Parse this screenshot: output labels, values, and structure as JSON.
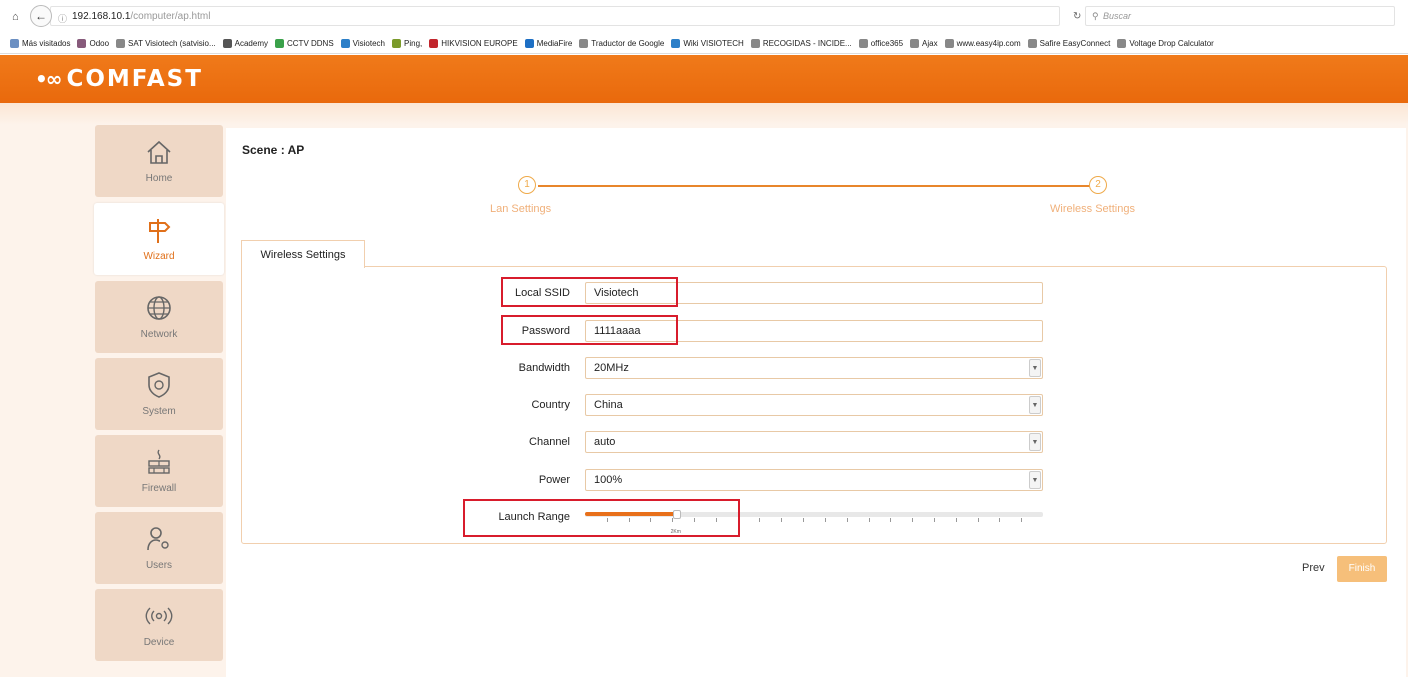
{
  "browser": {
    "url_host": "192.168.10.1",
    "url_path": "/computer/ap.html",
    "search_placeholder": "Buscar",
    "bookmarks": [
      {
        "label": "Más visitados",
        "color": "#6b8fc2"
      },
      {
        "label": "Odoo",
        "color": "#875a7b"
      },
      {
        "label": "SAT Visiotech (satvisio...",
        "color": "#888888"
      },
      {
        "label": "Academy",
        "color": "#555555"
      },
      {
        "label": "CCTV DDNS",
        "color": "#3aa14a"
      },
      {
        "label": "Visiotech",
        "color": "#2c7fc8"
      },
      {
        "label": "Ping,",
        "color": "#7a9a2a"
      },
      {
        "label": "HIKVISION EUROPE",
        "color": "#c2252c"
      },
      {
        "label": "MediaFire",
        "color": "#1d6fc4"
      },
      {
        "label": "Traductor de Google",
        "color": "#888888"
      },
      {
        "label": "Wiki VISIOTECH",
        "color": "#2c7fc8"
      },
      {
        "label": "RECOGIDAS - INCIDE...",
        "color": "#888888"
      },
      {
        "label": "office365",
        "color": "#888888"
      },
      {
        "label": "Ajax",
        "color": "#888888"
      },
      {
        "label": "www.easy4ip.com",
        "color": "#888888"
      },
      {
        "label": "Safire EasyConnect",
        "color": "#888888"
      },
      {
        "label": "Voltage Drop Calculator",
        "color": "#888888"
      }
    ]
  },
  "brand": {
    "logo_text": "COMFAST",
    "accent": "#e9690c"
  },
  "sidebar": {
    "items": [
      {
        "label": "Home",
        "icon": "home-icon",
        "active": false
      },
      {
        "label": "Wizard",
        "icon": "signpost-icon",
        "active": true
      },
      {
        "label": "Network",
        "icon": "globe-icon",
        "active": false
      },
      {
        "label": "System",
        "icon": "shield-icon",
        "active": false
      },
      {
        "label": "Firewall",
        "icon": "firewall-icon",
        "active": false
      },
      {
        "label": "Users",
        "icon": "users-icon",
        "active": false
      },
      {
        "label": "Device",
        "icon": "wireless-icon",
        "active": false
      }
    ]
  },
  "main": {
    "scene_title": "Scene : AP",
    "steps": [
      {
        "number": "1",
        "label": "Lan Settings"
      },
      {
        "number": "2",
        "label": "Wireless Settings"
      }
    ],
    "tab_label": "Wireless Settings"
  },
  "form": {
    "ssid_label": "Local SSID",
    "ssid_value": "Visiotech",
    "password_label": "Password",
    "password_value": "1111aaaa",
    "bandwidth_label": "Bandwidth",
    "bandwidth_value": "20MHz",
    "country_label": "Country",
    "country_value": "China",
    "channel_label": "Channel",
    "channel_value": "auto",
    "power_label": "Power",
    "power_value": "100%",
    "range_label": "Launch Range",
    "range_fraction": 0.2,
    "range_value_label": "2Km"
  },
  "actions": {
    "prev_label": "Prev",
    "finish_label": "Finish"
  }
}
